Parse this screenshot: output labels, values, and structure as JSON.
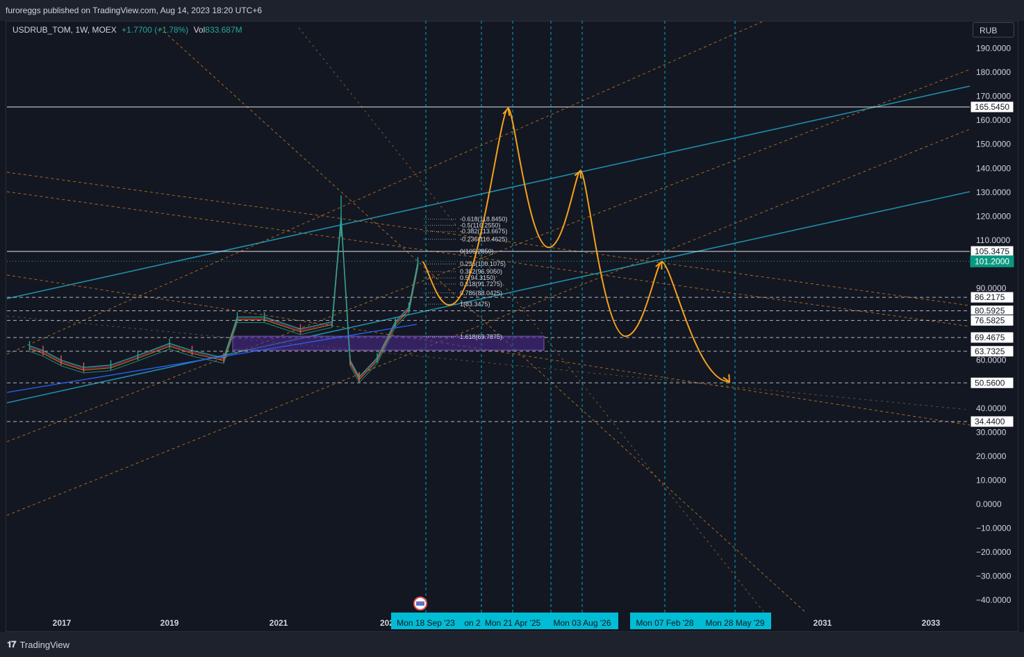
{
  "header": {
    "published": "furoreggs published on TradingView.com, Aug 14, 2023 18:20 UTC+6"
  },
  "legend": {
    "symbol": "USDRUB_TOM, 1W, MOEX",
    "change": "+1.7700 (+1.78%)",
    "vol_label": "Vol",
    "vol_value": "833.687M"
  },
  "currency_button": "RUB",
  "footer": {
    "brand": "TradingView"
  },
  "colors": {
    "background": "#131722",
    "channel": "#1e8fa8",
    "projection": "#f7a21b",
    "fib_dotted": "#b2b5be",
    "accent_badge": "#089981",
    "date_badge": "#00bcd4"
  },
  "chart_data": {
    "type": "line",
    "title": "",
    "xlabel": "",
    "ylabel": "",
    "x_ticks": [
      "2017",
      "2019",
      "2021",
      "202",
      "2031",
      "2033"
    ],
    "y_ticks": [
      "190.0000",
      "180.0000",
      "170.0000",
      "160.0000",
      "150.0000",
      "140.0000",
      "130.0000",
      "120.0000",
      "110.0000",
      "90.0000",
      "60.0000",
      "40.0000",
      "30.0000",
      "20.0000",
      "10.0000",
      "0.0000",
      "−10.0000",
      "−20.0000",
      "−30.0000",
      "−40.0000"
    ],
    "ylim": [
      -44,
      200
    ],
    "price_levels": [
      {
        "label": "165.5450",
        "value": 165.545,
        "style": "solid"
      },
      {
        "label": "105.3475",
        "value": 105.3475,
        "style": "solid"
      },
      {
        "label": "101.2000",
        "value": 101.2,
        "style": "current"
      },
      {
        "label": "86.2175",
        "value": 86.2175,
        "style": "dashed"
      },
      {
        "label": "80.5925",
        "value": 80.5925,
        "style": "dashed"
      },
      {
        "label": "76.5825",
        "value": 76.5825,
        "style": "dashed"
      },
      {
        "label": "69.4675",
        "value": 69.4675,
        "style": "dashed"
      },
      {
        "label": "63.7325",
        "value": 63.7325,
        "style": "dashed"
      },
      {
        "label": "50.5600",
        "value": 50.56,
        "style": "dashed"
      },
      {
        "label": "34.4400",
        "value": 34.44,
        "style": "dashed"
      }
    ],
    "fib_levels": [
      {
        "label": "-0.618(118.8450)",
        "value": 118.845
      },
      {
        "label": "-0.5(116.2550)",
        "value": 116.255
      },
      {
        "label": "-0.382(113.6675)",
        "value": 113.6675
      },
      {
        "label": "-0.236(110.4625)",
        "value": 110.4625
      },
      {
        "label": "0(105.2850)",
        "value": 105.285
      },
      {
        "label": "0.236(100.1075)",
        "value": 100.1075
      },
      {
        "label": "0.382(96.9050)",
        "value": 96.905
      },
      {
        "label": "0.5(94.3150)",
        "value": 94.315
      },
      {
        "label": "0.618(91.7275)",
        "value": 91.7275
      },
      {
        "label": "0.786(88.0425)",
        "value": 88.0425
      },
      {
        "label": "1(83.3475)",
        "value": 83.3475
      },
      {
        "label": "1.618(69.7875)",
        "value": 69.7875
      }
    ],
    "date_markers": [
      "Mon 18 Sep '23",
      "on 2",
      "Mon 21 Apr '25",
      "Mon 03 Aug '26",
      "Mon 07 Feb '28",
      "Mon 28 May '29"
    ],
    "projection_path": [
      {
        "date": "2023-09",
        "price": 101
      },
      {
        "date": "2024-03",
        "price": 83
      },
      {
        "date": "2025-04",
        "price": 165
      },
      {
        "date": "2026-01",
        "price": 107
      },
      {
        "date": "2026-08",
        "price": 139
      },
      {
        "date": "2027-06",
        "price": 70
      },
      {
        "date": "2028-02",
        "price": 101
      },
      {
        "date": "2029-05",
        "price": 51
      }
    ],
    "price_history": [
      {
        "date": "2016-06",
        "price": 66
      },
      {
        "date": "2016-09",
        "price": 64
      },
      {
        "date": "2017-01",
        "price": 60
      },
      {
        "date": "2017-06",
        "price": 57
      },
      {
        "date": "2017-12",
        "price": 58
      },
      {
        "date": "2018-06",
        "price": 62
      },
      {
        "date": "2019-01",
        "price": 67
      },
      {
        "date": "2019-06",
        "price": 64
      },
      {
        "date": "2020-01",
        "price": 61
      },
      {
        "date": "2020-04",
        "price": 78
      },
      {
        "date": "2020-10",
        "price": 78
      },
      {
        "date": "2021-06",
        "price": 73
      },
      {
        "date": "2022-01",
        "price": 76
      },
      {
        "date": "2022-03",
        "price": 120
      },
      {
        "date": "2022-05",
        "price": 60
      },
      {
        "date": "2022-07",
        "price": 53
      },
      {
        "date": "2022-11",
        "price": 61
      },
      {
        "date": "2023-03",
        "price": 76
      },
      {
        "date": "2023-06",
        "price": 82
      },
      {
        "date": "2023-08",
        "price": 101
      }
    ]
  }
}
